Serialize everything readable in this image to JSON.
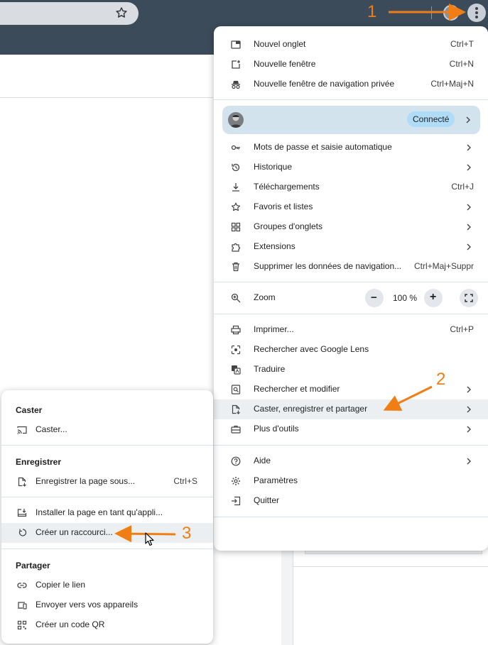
{
  "toolbar": {
    "icons": [
      "star-icon",
      "profile-icon",
      "menu-icon"
    ]
  },
  "main_menu": {
    "new_tab": {
      "label": "Nouvel onglet",
      "shortcut": "Ctrl+T"
    },
    "new_window": {
      "label": "Nouvelle fenêtre",
      "shortcut": "Ctrl+N"
    },
    "incognito": {
      "label": "Nouvelle fenêtre de navigation privée",
      "shortcut": "Ctrl+Maj+N"
    },
    "profile": {
      "status": "Connecté"
    },
    "passwords": {
      "label": "Mots de passe et saisie automatique"
    },
    "history": {
      "label": "Historique"
    },
    "downloads": {
      "label": "Téléchargements",
      "shortcut": "Ctrl+J"
    },
    "bookmarks": {
      "label": "Favoris et listes"
    },
    "tab_groups": {
      "label": "Groupes d'onglets"
    },
    "extensions": {
      "label": "Extensions"
    },
    "clear_data": {
      "label": "Supprimer les données de navigation...",
      "shortcut": "Ctrl+Maj+Suppr"
    },
    "zoom": {
      "label": "Zoom",
      "value": "100 %",
      "minus": "−",
      "plus": "+"
    },
    "print": {
      "label": "Imprimer...",
      "shortcut": "Ctrl+P"
    },
    "lens": {
      "label": "Rechercher avec Google Lens"
    },
    "translate": {
      "label": "Traduire"
    },
    "find": {
      "label": "Rechercher et modifier"
    },
    "cast": {
      "label": "Caster, enregistrer et partager"
    },
    "more_tools": {
      "label": "Plus d'outils"
    },
    "help": {
      "label": "Aide"
    },
    "settings": {
      "label": "Paramètres"
    },
    "quit": {
      "label": "Quitter"
    }
  },
  "submenu": {
    "cast_header": "Caster",
    "cast": {
      "label": "Caster..."
    },
    "save_header": "Enregistrer",
    "save_page": {
      "label": "Enregistrer la page sous...",
      "shortcut": "Ctrl+S"
    },
    "install": {
      "label": "Installer la page en tant qu'appli..."
    },
    "shortcut": {
      "label": "Créer un raccourci..."
    },
    "share_header": "Partager",
    "copy_link": {
      "label": "Copier le lien"
    },
    "send_devices": {
      "label": "Envoyer vers vos appareils"
    },
    "qr": {
      "label": "Créer un code QR"
    }
  },
  "annotations": {
    "step1": "1",
    "step2": "2",
    "step3": "3",
    "color": "#f07e14"
  }
}
